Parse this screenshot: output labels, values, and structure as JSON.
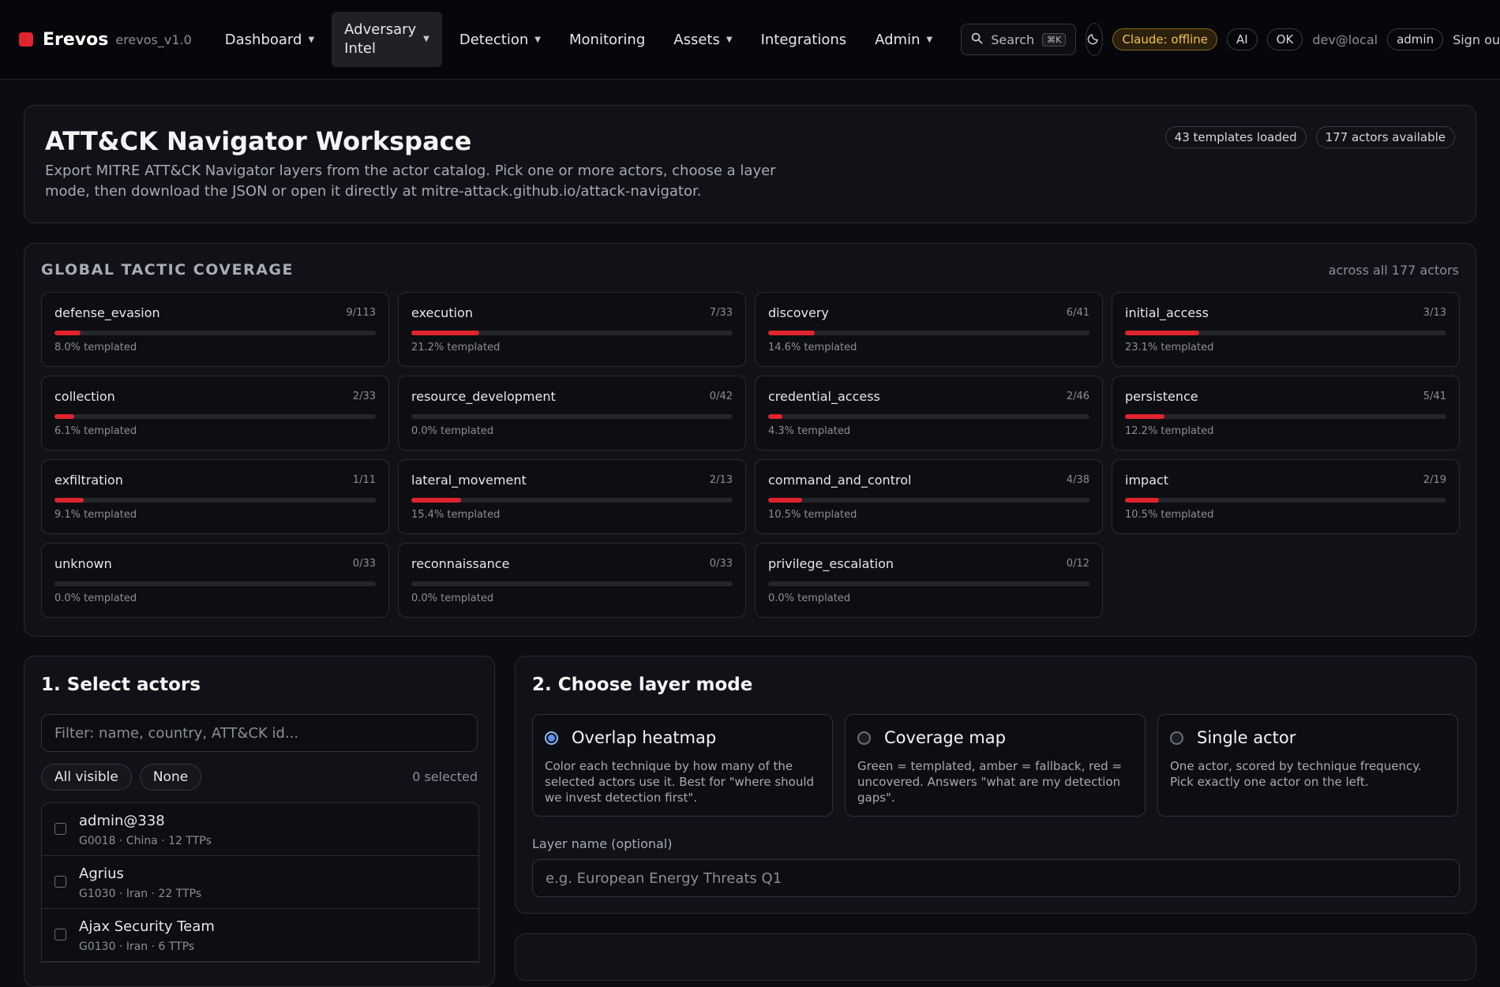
{
  "app": {
    "name": "Erevos",
    "version": "erevos_v1.0",
    "brand_color": "#e0242d"
  },
  "nav": {
    "items": [
      {
        "label": "Dashboard",
        "caret": true
      },
      {
        "label": "Adversary Intel",
        "caret": true,
        "active": true
      },
      {
        "label": "Detection",
        "caret": true
      },
      {
        "label": "Monitoring",
        "caret": false
      },
      {
        "label": "Assets",
        "caret": true
      },
      {
        "label": "Integrations",
        "caret": false
      },
      {
        "label": "Admin",
        "caret": true
      }
    ],
    "search_label": "Search",
    "search_shortcut": "⌘K",
    "status_claude": "Claude: offline",
    "status_ai": "AI",
    "status_ok": "OK",
    "user": "dev@local",
    "role": "admin",
    "signout": "Sign ou"
  },
  "hero": {
    "title": "ATT&CK Navigator Workspace",
    "description": "Export MITRE ATT&CK Navigator layers from the actor catalog. Pick one or more actors, choose a layer mode, then download the JSON or open it directly at mitre-attack.github.io/attack-navigator.",
    "badge_templates": "43 templates loaded",
    "badge_actors": "177 actors available"
  },
  "coverage": {
    "title": "GLOBAL TACTIC COVERAGE",
    "note": "across all 177 actors",
    "tactics": [
      {
        "name": "defense_evasion",
        "count": "9/113",
        "pct": 8.0,
        "pct_label": "8.0% templated"
      },
      {
        "name": "execution",
        "count": "7/33",
        "pct": 21.2,
        "pct_label": "21.2% templated"
      },
      {
        "name": "discovery",
        "count": "6/41",
        "pct": 14.6,
        "pct_label": "14.6% templated"
      },
      {
        "name": "initial_access",
        "count": "3/13",
        "pct": 23.1,
        "pct_label": "23.1% templated"
      },
      {
        "name": "collection",
        "count": "2/33",
        "pct": 6.1,
        "pct_label": "6.1% templated"
      },
      {
        "name": "resource_development",
        "count": "0/42",
        "pct": 0.0,
        "pct_label": "0.0% templated"
      },
      {
        "name": "credential_access",
        "count": "2/46",
        "pct": 4.3,
        "pct_label": "4.3% templated"
      },
      {
        "name": "persistence",
        "count": "5/41",
        "pct": 12.2,
        "pct_label": "12.2% templated"
      },
      {
        "name": "exfiltration",
        "count": "1/11",
        "pct": 9.1,
        "pct_label": "9.1% templated"
      },
      {
        "name": "lateral_movement",
        "count": "2/13",
        "pct": 15.4,
        "pct_label": "15.4% templated"
      },
      {
        "name": "command_and_control",
        "count": "4/38",
        "pct": 10.5,
        "pct_label": "10.5% templated"
      },
      {
        "name": "impact",
        "count": "2/19",
        "pct": 10.5,
        "pct_label": "10.5% templated"
      },
      {
        "name": "unknown",
        "count": "0/33",
        "pct": 0.0,
        "pct_label": "0.0% templated"
      },
      {
        "name": "reconnaissance",
        "count": "0/33",
        "pct": 0.0,
        "pct_label": "0.0% templated"
      },
      {
        "name": "privilege_escalation",
        "count": "0/12",
        "pct": 0.0,
        "pct_label": "0.0% templated"
      }
    ]
  },
  "actors": {
    "title": "1. Select actors",
    "filter_placeholder": "Filter: name, country, ATT&CK id...",
    "btn_all": "All visible",
    "btn_none": "None",
    "selected": "0 selected",
    "list": [
      {
        "name": "admin@338",
        "meta": "G0018 · China · 12 TTPs"
      },
      {
        "name": "Agrius",
        "meta": "G1030 · Iran · 22 TTPs"
      },
      {
        "name": "Ajax Security Team",
        "meta": "G0130 · Iran · 6 TTPs"
      }
    ]
  },
  "mode": {
    "title": "2. Choose layer mode",
    "options": [
      {
        "title": "Overlap heatmap",
        "desc": "Color each technique by how many of the selected actors use it. Best for \"where should we invest detection first\".",
        "selected": true
      },
      {
        "title": "Coverage map",
        "desc": "Green = templated, amber = fallback, red = uncovered. Answers \"what are my detection gaps\".",
        "selected": false
      },
      {
        "title": "Single actor",
        "desc": "One actor, scored by technique frequency. Pick exactly one actor on the left.",
        "selected": false
      }
    ],
    "layer_label": "Layer name (optional)",
    "layer_placeholder": "e.g. European Energy Threats Q1"
  }
}
